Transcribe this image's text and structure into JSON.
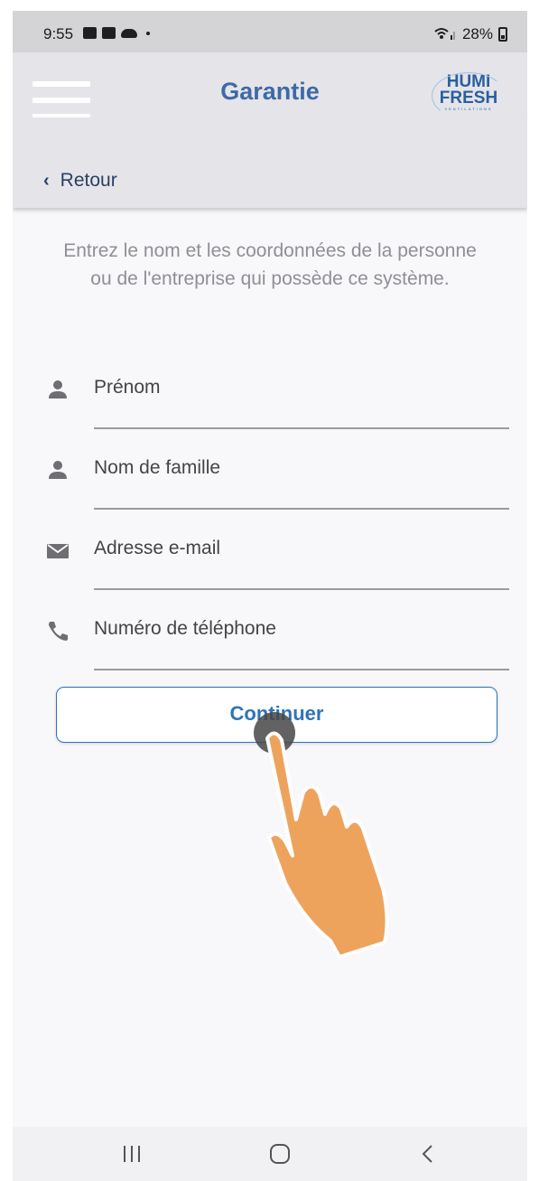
{
  "status_bar": {
    "time": "9:55",
    "battery": "28%"
  },
  "header": {
    "title": "Garantie",
    "logo_line1": "HUMI",
    "logo_line2": "FRESH",
    "logo_sub": "VENTILATIONS",
    "accent_color": "#3d6aa8"
  },
  "back": {
    "label": "Retour"
  },
  "intro": {
    "text": "Entrez le nom et les coordonnées de la personne ou de l'entreprise qui possède ce système."
  },
  "form": {
    "fields": [
      {
        "label": "Prénom",
        "icon": "person-icon"
      },
      {
        "label": "Nom de famille",
        "icon": "person-icon"
      },
      {
        "label": "Adresse e-mail",
        "icon": "mail-icon"
      },
      {
        "label": "Numéro de téléphone",
        "icon": "phone-icon"
      }
    ],
    "submit_label": "Continuer"
  },
  "nav": {
    "recent": "recent-apps-icon",
    "home": "home-icon",
    "back": "back-icon"
  }
}
